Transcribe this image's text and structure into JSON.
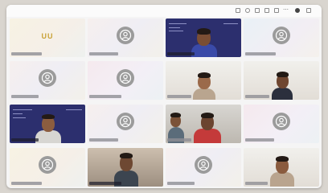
{
  "toolbar": {
    "icons": [
      "layout-icon",
      "record-icon",
      "mic-icon",
      "camera-icon",
      "share-icon",
      "more-icon",
      "profile-icon",
      "raise-hand-icon"
    ]
  },
  "participants": [
    {
      "id": "p1",
      "type": "initials",
      "initials": "UU",
      "bg": "yellowish"
    },
    {
      "id": "p2",
      "type": "avatar",
      "bg": "light"
    },
    {
      "id": "p3",
      "type": "video-slide",
      "bg": "navy"
    },
    {
      "id": "p4",
      "type": "avatar",
      "bg": "bluish"
    },
    {
      "id": "p5",
      "type": "avatar",
      "bg": "light"
    },
    {
      "id": "p6",
      "type": "avatar",
      "bg": "pinkish"
    },
    {
      "id": "p7",
      "type": "video",
      "bg": "bright"
    },
    {
      "id": "p8",
      "type": "video",
      "bg": "bright"
    },
    {
      "id": "p9",
      "type": "video-slide",
      "bg": "navy"
    },
    {
      "id": "p10",
      "type": "avatar",
      "bg": "light"
    },
    {
      "id": "p11",
      "type": "video",
      "bg": "room"
    },
    {
      "id": "p12",
      "type": "avatar",
      "bg": "pinkish"
    },
    {
      "id": "p13",
      "type": "avatar",
      "bg": "yellowish"
    },
    {
      "id": "p14",
      "type": "video",
      "bg": "warm"
    },
    {
      "id": "p15",
      "type": "avatar",
      "bg": "light"
    },
    {
      "id": "p16",
      "type": "video",
      "bg": "bright"
    }
  ],
  "colors": {
    "avatar_gray": "#9b9b9b",
    "initials_gold": "#c9a236",
    "slide_navy": "#2c2f6e",
    "window_bg": "#f5f5f5"
  }
}
